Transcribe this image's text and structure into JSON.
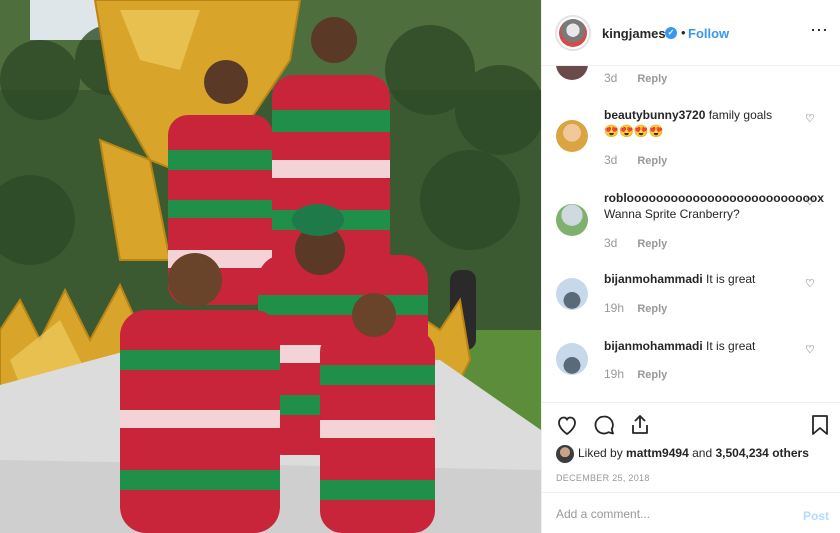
{
  "header": {
    "username": "kingjames",
    "separator": "•",
    "follow_label": "Follow",
    "more_icon": "⋯"
  },
  "comments": [
    {
      "user": "",
      "text": "",
      "age": "3d",
      "reply": "Reply",
      "avatar_color": "#6b4b49"
    },
    {
      "user": "beautybunny3720",
      "text": "family goals",
      "emoji": "😍😍😍😍",
      "age": "3d",
      "reply": "Reply",
      "avatar_color": "#d9a441"
    },
    {
      "user": "robloooooooooooooooooooooooooox",
      "text": "Wanna Sprite Cranberry?",
      "age": "3d",
      "reply": "Reply",
      "avatar_color": "#7fb06d"
    },
    {
      "user": "bijanmohammadi",
      "text": "It is great",
      "age": "19h",
      "reply": "Reply",
      "avatar_color": "#8aa9c9"
    },
    {
      "user": "bijanmohammadi",
      "text": "It is great",
      "age": "19h",
      "reply": "Reply",
      "avatar_color": "#8aa9c9"
    }
  ],
  "actions": {
    "liked_by_prefix": "Liked by",
    "liked_by_user": "mattm9494",
    "liked_by_and": "and",
    "likes_count": "3,504,234 others",
    "date": "DECEMBER 25, 2018"
  },
  "add_comment": {
    "placeholder": "Add a comment...",
    "post_label": "Post"
  },
  "colors": {
    "accent": "#3897f0",
    "post_disabled": "#b3dbff",
    "muted": "#999999"
  }
}
